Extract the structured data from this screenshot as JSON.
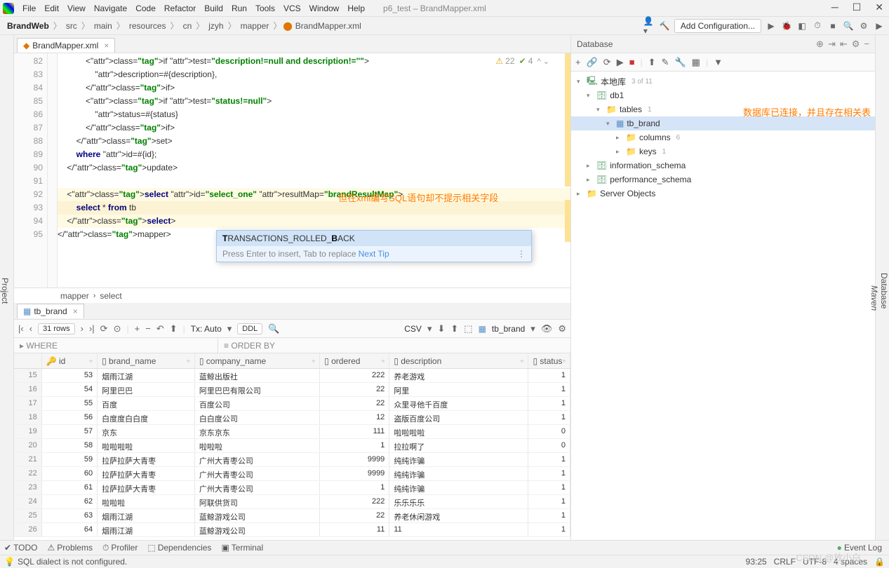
{
  "window": {
    "title": "p6_test – BrandMapper.xml"
  },
  "menu": [
    "File",
    "Edit",
    "View",
    "Navigate",
    "Code",
    "Refactor",
    "Build",
    "Run",
    "Tools",
    "VCS",
    "Window",
    "Help"
  ],
  "breadcrumbs": [
    "BrandWeb",
    "src",
    "main",
    "resources",
    "cn",
    "jzyh",
    "mapper",
    "BrandMapper.xml"
  ],
  "navRight": {
    "addConfig": "Add Configuration..."
  },
  "leftStrip": {
    "project": "Project"
  },
  "rightStrip": {
    "database": "Database",
    "maven": "Maven"
  },
  "editorTab": {
    "name": "BrandMapper.xml"
  },
  "warnings": {
    "yellow": "22",
    "green": "4"
  },
  "lines": [
    82,
    83,
    84,
    85,
    86,
    87,
    88,
    89,
    90,
    91,
    92,
    93,
    94,
    95
  ],
  "codeText": {
    "l82": "            <if test=\"description!=null and description!=''\">",
    "l83": "                description=#{description},",
    "l84": "            </if>",
    "l85": "            <if test=\"status!=null\">",
    "l86": "                status=#{status}",
    "l87": "            </if>",
    "l88": "        </set>",
    "l89": "        where id=#{id};",
    "l90": "    </update>",
    "l91": "",
    "l92": "    <select id=\"select_one\" resultMap=\"brandResultMap\">",
    "l93": "        select * from tb",
    "l94": "    </select>",
    "l95": "</mapper>"
  },
  "annotation1": "但在xml编写SQL语句却不提示相关字段",
  "annotation2": "数据库已连接，并且存在相关表",
  "popup": {
    "item": "TRANSACTIONS_ROLLED_BACK",
    "hint": "Press Enter to insert, Tab to replace",
    "link": "Next Tip"
  },
  "codeCrumb": [
    "mapper",
    "select"
  ],
  "dataTab": "tb_brand",
  "dataToolbar": {
    "rows": "31 rows",
    "tx": "Tx: Auto",
    "ddl": "DDL",
    "csv": "CSV",
    "table": "tb_brand"
  },
  "filterLabels": {
    "where": "WHERE",
    "order": "ORDER BY"
  },
  "columns": [
    "id",
    "brand_name",
    "company_name",
    "ordered",
    "description",
    "status"
  ],
  "rows": [
    {
      "n": 15,
      "id": 53,
      "brand": "烟雨江湖",
      "company": "蓝鲸出版社",
      "ordered": 222,
      "desc": "养老游戏",
      "status": 1
    },
    {
      "n": 16,
      "id": 54,
      "brand": "阿里巴巴",
      "company": "阿里巴巴有限公司",
      "ordered": 22,
      "desc": "阿里",
      "status": 1
    },
    {
      "n": 17,
      "id": 55,
      "brand": "百度",
      "company": "百度公司",
      "ordered": 22,
      "desc": "众里寻他千百度",
      "status": 1
    },
    {
      "n": 18,
      "id": 56,
      "brand": "白度度白白度",
      "company": "白白度公司",
      "ordered": 12,
      "desc": "盗版百度公司",
      "status": 1
    },
    {
      "n": 19,
      "id": 57,
      "brand": "京东",
      "company": "京东京东",
      "ordered": 111,
      "desc": "啦啦啦啦",
      "status": 0
    },
    {
      "n": 20,
      "id": 58,
      "brand": "啦啦啦啦",
      "company": "啦啦啦",
      "ordered": 1,
      "desc": "拉拉啊了",
      "status": 0
    },
    {
      "n": 21,
      "id": 59,
      "brand": "拉萨拉萨大青枣",
      "company": "广州大青枣公司",
      "ordered": 9999,
      "desc": "纯纯诈骗",
      "status": 1
    },
    {
      "n": 22,
      "id": 60,
      "brand": "拉萨拉萨大青枣",
      "company": "广州大青枣公司",
      "ordered": 9999,
      "desc": "纯纯诈骗",
      "status": 1
    },
    {
      "n": 23,
      "id": 61,
      "brand": "拉萨拉萨大青枣",
      "company": "广州大青枣公司",
      "ordered": 1,
      "desc": "纯纯诈骗",
      "status": 1
    },
    {
      "n": 24,
      "id": 62,
      "brand": "啦啦啦",
      "company": "阿联供货司",
      "ordered": 222,
      "desc": "乐乐乐乐",
      "status": 1
    },
    {
      "n": 25,
      "id": 63,
      "brand": "烟雨江湖",
      "company": "蓝鲸游戏公司",
      "ordered": 22,
      "desc": "养老休闲游戏",
      "status": 1
    },
    {
      "n": 26,
      "id": 64,
      "brand": "烟雨江湖",
      "company": "蓝鲸游戏公司",
      "ordered": 11,
      "desc": "11",
      "status": 1
    }
  ],
  "dbPanel": {
    "title": "Database",
    "local": "本地库",
    "localCnt": "3 of 11",
    "db1": "db1",
    "tables": "tables",
    "tablesCnt": "1",
    "tbBrand": "tb_brand",
    "columns": "columns",
    "columnsCnt": "6",
    "keys": "keys",
    "keysCnt": "1",
    "infoSchema": "information_schema",
    "perfSchema": "performance_schema",
    "serverObj": "Server Objects"
  },
  "bottomTabs": [
    "TODO",
    "Problems",
    "Profiler",
    "Dependencies",
    "Terminal"
  ],
  "eventLog": "Event Log",
  "status": {
    "msg": "SQL dialect is not configured.",
    "pos": "93:25",
    "crlf": "CRLF",
    "enc": "UTF-8",
    "indent": "4 spaces"
  },
  "watermark": "CSDN @放小白"
}
